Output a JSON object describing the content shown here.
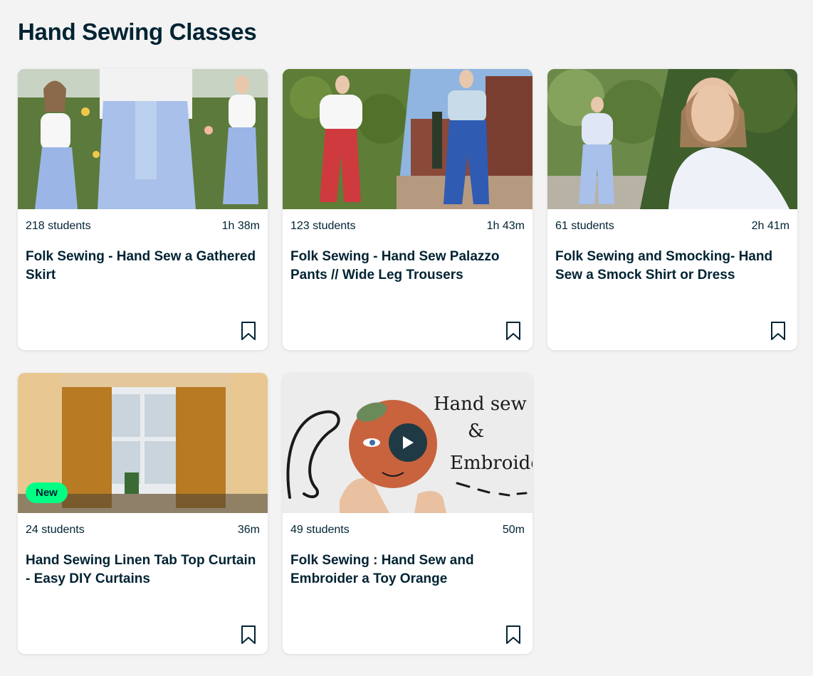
{
  "page": {
    "title": "Hand Sewing Classes"
  },
  "cards": [
    {
      "students": "218 students",
      "duration": "1h 38m",
      "title": "Folk Sewing - Hand Sew a Gathered Skirt",
      "bookmark_icon": "bookmark-icon"
    },
    {
      "students": "123 students",
      "duration": "1h 43m",
      "title": "Folk Sewing - Hand Sew Palazzo Pants // Wide Leg Trousers",
      "bookmark_icon": "bookmark-icon"
    },
    {
      "students": "61 students",
      "duration": "2h 41m",
      "title": "Folk Sewing and Smocking- Hand Sew a Smock Shirt or Dress",
      "bookmark_icon": "bookmark-icon"
    },
    {
      "students": "24 students",
      "duration": "36m",
      "title": "Hand Sewing Linen Tab Top Curtain - Easy DIY Curtains",
      "badge": "New",
      "bookmark_icon": "bookmark-icon"
    },
    {
      "students": "49 students",
      "duration": "50m",
      "title": "Folk Sewing : Hand Sew and Embroider a Toy Orange",
      "thumbnail_text": [
        "Hand sew",
        "&",
        "Embroider"
      ],
      "bookmark_icon": "bookmark-icon",
      "play_icon": "play-icon"
    }
  ],
  "colors": {
    "text": "#002333",
    "background": "#f3f3f3",
    "badge": "#00ff84",
    "card1_border": "#e8e82a",
    "card2_border": "#f08ad8"
  }
}
